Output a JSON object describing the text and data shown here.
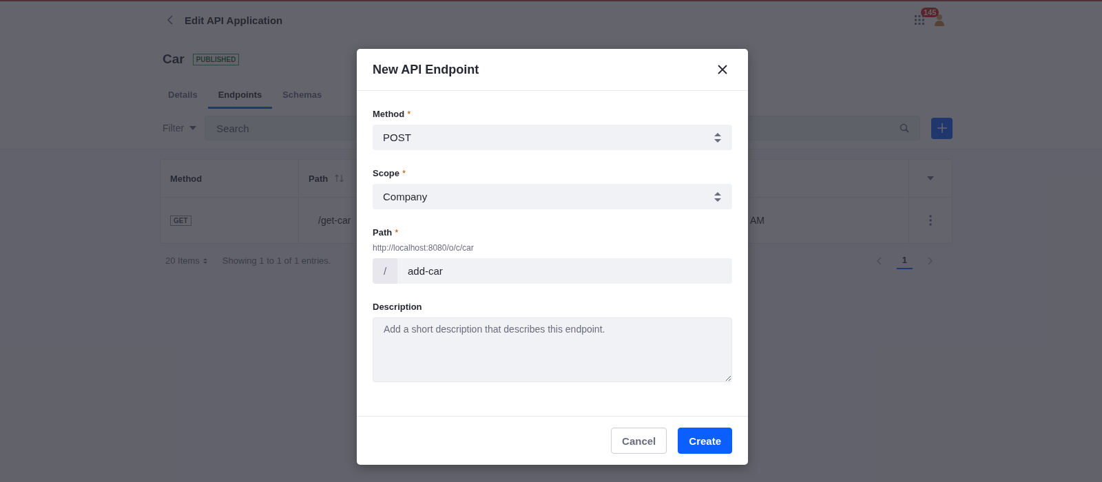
{
  "header": {
    "title": "Edit API Application",
    "notification_count": "145"
  },
  "application": {
    "name": "Car",
    "status": "PUBLISHED"
  },
  "tabs": [
    {
      "label": "Details",
      "selected": false
    },
    {
      "label": "Endpoints",
      "selected": true
    },
    {
      "label": "Schemas",
      "selected": false
    }
  ],
  "toolbar": {
    "filter_label": "Filter",
    "search_placeholder": "Search"
  },
  "table": {
    "columns": [
      "Method",
      "Path"
    ],
    "rows": [
      {
        "method": "GET",
        "path": "/get-car",
        "column_3": "AM"
      }
    ]
  },
  "pagination": {
    "items_per_page": "20 Items",
    "summary": "Showing 1 to 1 of 1 entries.",
    "pages": [
      {
        "label": "1",
        "selected": true
      }
    ]
  },
  "modal": {
    "title": "New API Endpoint",
    "fields": [
      {
        "kind": "select",
        "label": "Method",
        "required_mark": "*",
        "value": "POST"
      },
      {
        "kind": "select",
        "label": "Scope",
        "required_mark": "*",
        "value": "Company"
      },
      {
        "kind": "prefixed",
        "label": "Path",
        "required_mark": "*",
        "help": "http://localhost:8080/o/c/car",
        "prefix": "/",
        "value": "add-car"
      },
      {
        "kind": "textarea",
        "label": "Description",
        "placeholder": "Add a short description that describes this endpoint."
      }
    ],
    "buttons": [
      {
        "label": "Cancel",
        "kind": "secondary"
      },
      {
        "label": "Create",
        "kind": "primary"
      }
    ]
  }
}
